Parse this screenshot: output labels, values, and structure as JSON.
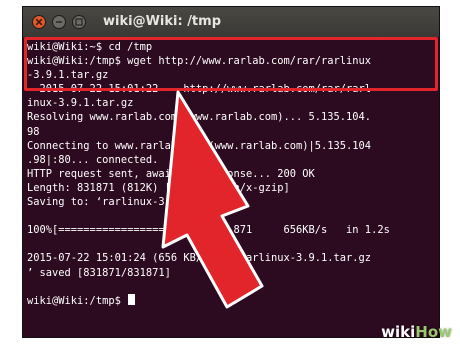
{
  "window": {
    "title": "wiki@Wiki: /tmp"
  },
  "terminal": {
    "lines": [
      "wiki@Wiki:~$ cd /tmp",
      "wiki@Wiki:/tmp$ wget http://www.rarlab.com/rar/rarlinux",
      "-3.9.1.tar.gz",
      "--2015-07-22 15:01:22--  http://www.rarlab.com/rar/rarl",
      "inux-3.9.1.tar.gz",
      "Resolving www.rarlab.com (www.rarlab.com)... 5.135.104.",
      "98",
      "Connecting to www.rarlab.com (www.rarlab.com)|5.135.104",
      ".98|:80... connected.",
      "HTTP request sent, awaiting response... 200 OK",
      "Length: 831871 (812K) [application/x-gzip]",
      "Saving to: ‘rarlinux-3.9.1.tar.gz’",
      "",
      "100%[=====================>] 831,871     656KB/s   in 1.2s",
      "",
      "2015-07-22 15:01:24 (656 KB/s) - ‘rarlinux-3.9.1.tar.gz",
      "’ saved [831871/831871]",
      "",
      "wiki@Wiki:/tmp$ "
    ]
  },
  "watermark": {
    "wiki": "wiki",
    "how": "How"
  },
  "colors": {
    "terminal_bg": "#2c0a1f",
    "highlight": "#e2242b",
    "close_button": "#e0582c",
    "watermark_how": "#9bc86e"
  },
  "icons": [
    "close-icon",
    "minimize-icon",
    "maximize-icon",
    "red-arrow-pointer-icon"
  ]
}
